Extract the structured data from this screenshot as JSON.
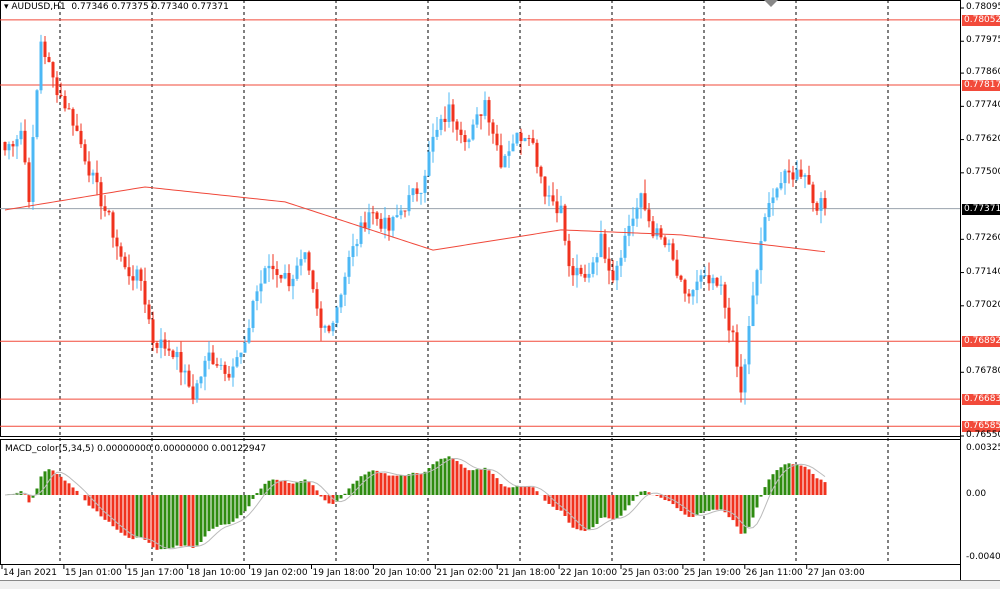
{
  "header": {
    "symbol": "AUDUSD",
    "timeframe": "H1",
    "ohlc": "0.77346 0.77375 0.77340 0.77371"
  },
  "macd": {
    "title": "MACD_color(5,34,5) 0.00000000 0.00000000 0.00122947",
    "scale": [
      "0.003253",
      "0.00",
      "-0.00402"
    ]
  },
  "colors": {
    "bull": "#4cb8f5",
    "bear": "#f0321e",
    "level": "#f24a3a",
    "macd_up": "#2e8b10",
    "macd_down": "#f0321e",
    "ma": "#f0483a",
    "price_line": "#9aa3ad"
  },
  "price_axis": [
    "0.78095",
    "0.77975",
    "0.77860",
    "0.77740",
    "0.77620",
    "0.77500",
    "0.77260",
    "0.77140",
    "0.77020",
    "0.76780",
    "0.76550"
  ],
  "levels": [
    "0.78052",
    "0.77817",
    "0.76892",
    "0.76683",
    "0.76585"
  ],
  "current_price": "0.77371",
  "time_axis": [
    "14 Jan 2021",
    "15 Jan 01:00",
    "15 Jan 17:00",
    "18 Jan 10:00",
    "19 Jan 02:00",
    "19 Jan 18:00",
    "20 Jan 10:00",
    "21 Jan 02:00",
    "21 Jan 18:00",
    "22 Jan 10:00",
    "25 Jan 03:00",
    "25 Jan 19:00",
    "26 Jan 11:00",
    "27 Jan 03:00"
  ],
  "chart_data": {
    "type": "candlestick",
    "price_range": [
      0.7655,
      0.78095
    ],
    "close_anchors": [
      [
        0,
        0.77582
      ],
      [
        4,
        0.77655
      ],
      [
        6,
        0.7742
      ],
      [
        9,
        0.77979
      ],
      [
        12,
        0.77835
      ],
      [
        17,
        0.77691
      ],
      [
        22,
        0.77474
      ],
      [
        26,
        0.7733
      ],
      [
        30,
        0.77149
      ],
      [
        34,
        0.77113
      ],
      [
        37,
        0.76896
      ],
      [
        42,
        0.7686
      ],
      [
        47,
        0.76698
      ],
      [
        51,
        0.76842
      ],
      [
        56,
        0.76788
      ],
      [
        60,
        0.7686
      ],
      [
        62,
        0.77041
      ],
      [
        66,
        0.77167
      ],
      [
        71,
        0.77113
      ],
      [
        75,
        0.77185
      ],
      [
        79,
        0.76932
      ],
      [
        82,
        0.76969
      ],
      [
        86,
        0.77185
      ],
      [
        91,
        0.77366
      ],
      [
        96,
        0.77294
      ],
      [
        99,
        0.77366
      ],
      [
        104,
        0.77456
      ],
      [
        107,
        0.77618
      ],
      [
        111,
        0.77727
      ],
      [
        116,
        0.77618
      ],
      [
        120,
        0.77763
      ],
      [
        124,
        0.77546
      ],
      [
        127,
        0.77618
      ],
      [
        131,
        0.77655
      ],
      [
        135,
        0.77438
      ],
      [
        139,
        0.77366
      ],
      [
        141,
        0.77149
      ],
      [
        145,
        0.77113
      ],
      [
        149,
        0.77257
      ],
      [
        152,
        0.77131
      ],
      [
        156,
        0.77312
      ],
      [
        159,
        0.77402
      ],
      [
        162,
        0.77294
      ],
      [
        166,
        0.77221
      ],
      [
        170,
        0.77041
      ],
      [
        174,
        0.77113
      ],
      [
        179,
        0.77077
      ],
      [
        182,
        0.76896
      ],
      [
        184,
        0.76698
      ],
      [
        186,
        0.76932
      ],
      [
        189,
        0.77257
      ],
      [
        192,
        0.77438
      ],
      [
        196,
        0.77492
      ],
      [
        200,
        0.7751
      ],
      [
        202,
        0.77402
      ],
      [
        205,
        0.77371
      ]
    ],
    "ma_anchors": [
      [
        0,
        0.77366
      ],
      [
        35,
        0.77449
      ],
      [
        70,
        0.77395
      ],
      [
        107,
        0.77221
      ],
      [
        139,
        0.77294
      ],
      [
        169,
        0.77276
      ],
      [
        205,
        0.77215
      ]
    ],
    "indicator": "MACD_color(5,34,5)"
  }
}
